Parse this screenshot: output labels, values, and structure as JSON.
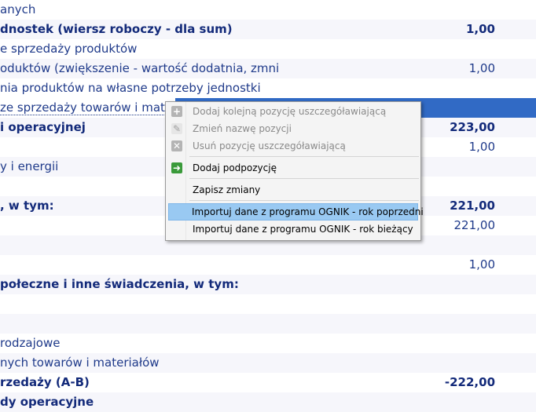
{
  "rows": [
    {
      "label": "anych",
      "value": "",
      "bold": false
    },
    {
      "label": "dnostek (wiersz roboczy - dla sum)",
      "value": "1,00",
      "bold": true
    },
    {
      "label": "e sprzedaży produktów",
      "value": "",
      "bold": false
    },
    {
      "label": "oduktów (zwiększenie - wartość dodatnia, zmni",
      "value": "1,00",
      "bold": false
    },
    {
      "label": "nia produktów na własne potrzeby jednostki",
      "value": "",
      "bold": false
    },
    {
      "label": "ze sprzedaży towarów i mate",
      "value": "",
      "bold": false
    },
    {
      "label": "i operacyjnej",
      "value": "223,00",
      "bold": true
    },
    {
      "label": "",
      "value": "1,00",
      "bold": false
    },
    {
      "label": "y i energii",
      "value": "",
      "bold": false
    },
    {
      "label": "",
      "value": "",
      "bold": false
    },
    {
      "label": ", w tym:",
      "value": "221,00",
      "bold": true
    },
    {
      "label": "",
      "value": "221,00",
      "bold": false
    },
    {
      "label": "",
      "value": "",
      "bold": false
    },
    {
      "label": "",
      "value": "1,00",
      "bold": false
    },
    {
      "label": "połeczne i inne świadczenia, w tym:",
      "value": "",
      "bold": true
    },
    {
      "label": "",
      "value": "",
      "bold": false
    },
    {
      "label": "",
      "value": "",
      "bold": false
    },
    {
      "label": "rodzajowe",
      "value": "",
      "bold": false
    },
    {
      "label": "nych towarów i materiałów",
      "value": "",
      "bold": false
    },
    {
      "label": "rzedaży (A-B)",
      "value": "-222,00",
      "bold": true
    },
    {
      "label": "dy operacyjne",
      "value": "",
      "bold": true
    }
  ],
  "context_menu": {
    "items": [
      {
        "label": "Dodaj kolejną pozycję uszczegóławiającą",
        "icon": "plus-icon",
        "disabled": true
      },
      {
        "label": "Zmień nazwę pozycji",
        "icon": "edit-icon",
        "disabled": true
      },
      {
        "label": "Usuń pozycję uszczegóławiającą",
        "icon": "delete-icon",
        "disabled": true
      },
      {
        "label": "Dodaj podpozycję",
        "icon": "add-subitem-icon",
        "disabled": false
      },
      {
        "label": "Zapisz zmiany",
        "icon": "",
        "disabled": false
      },
      {
        "label": "Importuj dane z programu OGNIK - rok poprzedni",
        "icon": "",
        "disabled": false,
        "highlighted": true
      },
      {
        "label": "Importuj dane z programu OGNIK - rok bieżący",
        "icon": "",
        "disabled": false
      }
    ]
  },
  "colors": {
    "text": "#1f3a8a",
    "selection": "#316ac5",
    "menu_highlight": "#99c9f2"
  }
}
